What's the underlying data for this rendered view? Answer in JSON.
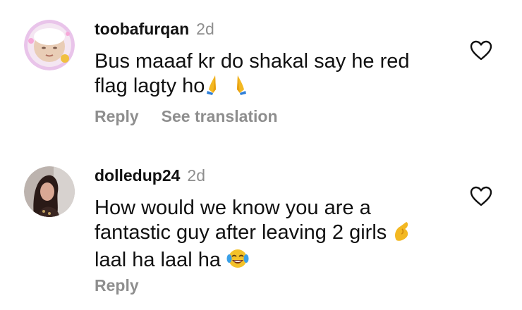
{
  "comments": [
    {
      "username": "toobafurqan",
      "time": "2d",
      "text": "Bus maaaf kr do shakal say he red flag lagty ho",
      "emoji": [
        "folded-hands-emoji",
        "folded-hands-emoji"
      ],
      "actions": {
        "reply": "Reply",
        "translate": "See translation"
      },
      "like_icon": "heart-outline-icon"
    },
    {
      "username": "dolledup24",
      "time": "2d",
      "text_line1": "How would we know you are a",
      "text_line2": "fantastic guy after leaving 2 girls",
      "text_line3": "laal ha laal ha",
      "emoji": [
        "pinching-hand-emoji",
        "face-with-tears-of-joy-emoji"
      ],
      "actions": {
        "reply": "Reply"
      },
      "like_icon": "heart-outline-icon"
    }
  ],
  "colors": {
    "text": "#111111",
    "secondary": "#8e8e8e",
    "background": "#ffffff"
  }
}
